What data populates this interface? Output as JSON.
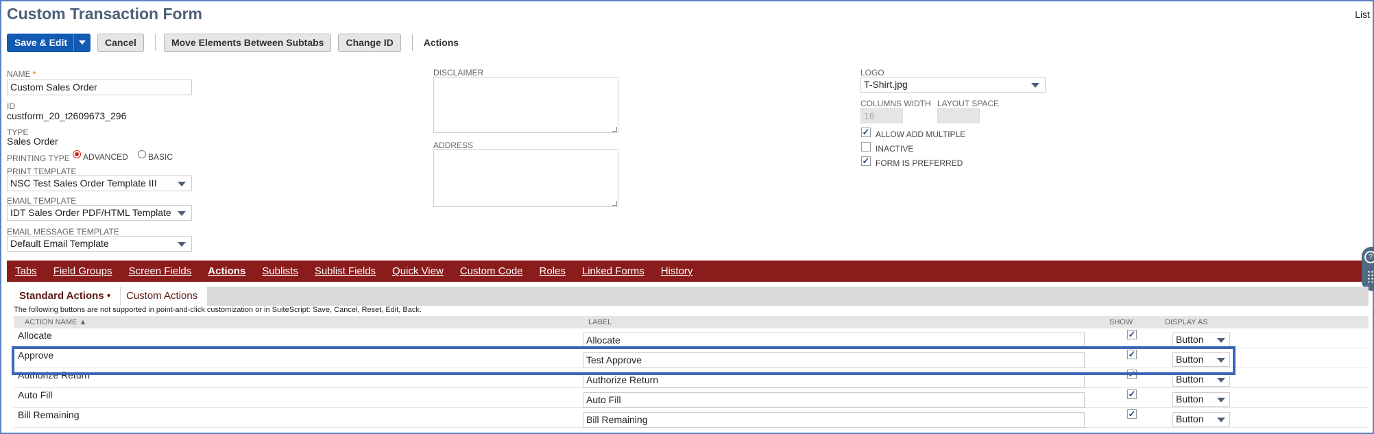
{
  "page": {
    "title": "Custom Transaction Form",
    "list_link": "List"
  },
  "toolbar": {
    "save_edit": "Save & Edit",
    "cancel": "Cancel",
    "move_elements": "Move Elements Between Subtabs",
    "change_id": "Change ID",
    "actions": "Actions"
  },
  "form": {
    "name_label": "NAME",
    "name_value": "Custom Sales Order",
    "id_label": "ID",
    "id_value": "custform_20_t2609673_296",
    "type_label": "TYPE",
    "type_value": "Sales Order",
    "printing_type_label": "PRINTING TYPE",
    "printing_advanced": "ADVANCED",
    "printing_basic": "BASIC",
    "print_template_label": "PRINT TEMPLATE",
    "print_template_value": "NSC Test Sales Order Template III",
    "email_template_label": "EMAIL TEMPLATE",
    "email_template_value": "IDT Sales Order PDF/HTML Template",
    "email_message_label": "EMAIL MESSAGE TEMPLATE",
    "email_message_value": "Default Email Template",
    "disclaimer_label": "DISCLAIMER",
    "address_label": "ADDRESS",
    "logo_label": "LOGO",
    "logo_value": "T-Shirt.jpg",
    "columns_width_label": "COLUMNS WIDTH",
    "columns_width_value": "16",
    "layout_space_label": "LAYOUT SPACE",
    "allow_add_multiple": "ALLOW ADD MULTIPLE",
    "allow_add_multiple_checked": true,
    "inactive": "INACTIVE",
    "inactive_checked": false,
    "form_preferred": "FORM IS PREFERRED",
    "form_preferred_checked": true
  },
  "subtabs": {
    "tabs": "Tabs",
    "field_groups": "Field Groups",
    "screen_fields": "Screen Fields",
    "actions": "Actions",
    "sublists": "Sublists",
    "sublist_fields": "Sublist Fields",
    "quick_view": "Quick View",
    "custom_code": "Custom Code",
    "roles": "Roles",
    "linked_forms": "Linked Forms",
    "history": "History",
    "active": "Actions"
  },
  "actions_tab": {
    "standard_actions": "Standard Actions",
    "custom_actions": "Custom Actions",
    "note": "The following buttons are not supported in point-and-click customization or in SuiteScript: Save, Cancel, Reset, Edit, Back.",
    "col_action_name": "ACTION NAME ▲",
    "col_label": "LABEL",
    "col_show": "SHOW",
    "col_display_as": "DISPLAY AS",
    "rows": [
      {
        "name": "Allocate",
        "label": "Allocate",
        "show": true,
        "display": "Button"
      },
      {
        "name": "Approve",
        "label": "Test Approve",
        "show": true,
        "display": "Button"
      },
      {
        "name": "Authorize Return",
        "label": "Authorize Return",
        "show": true,
        "display": "Button"
      },
      {
        "name": "Auto Fill",
        "label": "Auto Fill",
        "show": true,
        "display": "Button"
      },
      {
        "name": "Bill Remaining",
        "label": "Bill Remaining",
        "show": true,
        "display": "Button"
      }
    ],
    "highlighted_row": "Approve"
  },
  "colors": {
    "primary": "#125ab2",
    "subtab_bar": "#8b1c1c",
    "title": "#4d5f79",
    "highlight": "#3d66b8",
    "required": "#e8a317"
  }
}
